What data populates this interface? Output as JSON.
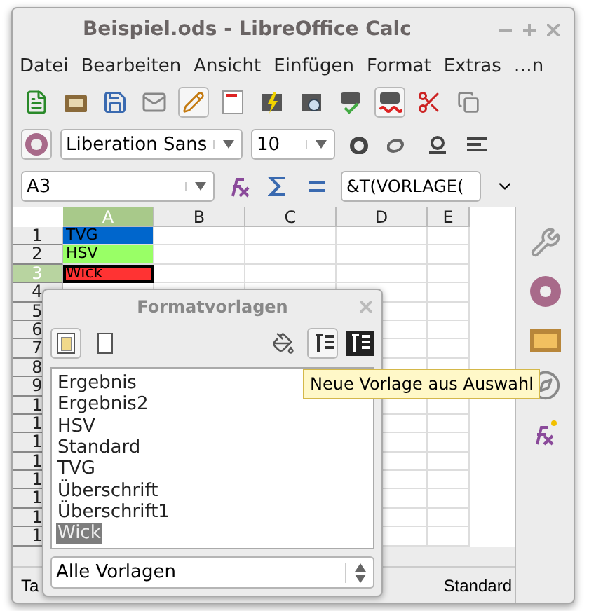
{
  "window": {
    "title": "Beispiel.ods - LibreOffice Calc"
  },
  "menu": [
    "Datei",
    "Bearbeiten",
    "Ansicht",
    "Einfügen",
    "Format",
    "Extras",
    "…n"
  ],
  "font_name": {
    "value": "Liberation Sans"
  },
  "font_size": {
    "value": "10"
  },
  "name_box": {
    "value": "A3"
  },
  "formula": {
    "value": "&T(VORLAGE("
  },
  "columns": [
    {
      "label": "A",
      "selected": true
    },
    {
      "label": "B",
      "selected": false
    },
    {
      "label": "C",
      "selected": false
    },
    {
      "label": "D",
      "selected": false
    },
    {
      "label": "E",
      "selected": false
    }
  ],
  "rows": [
    {
      "label": "1",
      "selected": false,
      "cell": {
        "text": "TVG",
        "color": "#0066cc"
      }
    },
    {
      "label": "2",
      "selected": false,
      "cell": {
        "text": "HSV",
        "color": "#99ff66"
      }
    },
    {
      "label": "3",
      "selected": true,
      "cell": {
        "text": "Wick",
        "color": "#ff3333"
      }
    },
    {
      "label": "4",
      "selected": false
    },
    {
      "label": "5",
      "selected": false
    },
    {
      "label": "6",
      "selected": false
    },
    {
      "label": "7",
      "selected": false
    },
    {
      "label": "8",
      "selected": false
    },
    {
      "label": "9",
      "selected": false
    },
    {
      "label": "1",
      "selected": false
    },
    {
      "label": "1",
      "selected": false
    },
    {
      "label": "1",
      "selected": false
    },
    {
      "label": "1",
      "selected": false
    },
    {
      "label": "1",
      "selected": false
    },
    {
      "label": "1",
      "selected": false
    },
    {
      "label": "1",
      "selected": false
    },
    {
      "label": "1",
      "selected": false
    }
  ],
  "dialog": {
    "title": "Formatvorlagen",
    "categories": [
      {
        "kind": "cell",
        "selected": true
      },
      {
        "kind": "page",
        "selected": false
      }
    ],
    "styles": [
      {
        "name": "Ergebnis",
        "selected": false
      },
      {
        "name": "Ergebnis2",
        "selected": false
      },
      {
        "name": "HSV",
        "selected": false
      },
      {
        "name": "Standard",
        "selected": false
      },
      {
        "name": "TVG",
        "selected": false
      },
      {
        "name": "Überschrift",
        "selected": false
      },
      {
        "name": "Überschrift1",
        "selected": false
      },
      {
        "name": "Wick",
        "selected": true
      }
    ],
    "filter": {
      "value": "Alle Vorlagen"
    },
    "tooltip": "Neue Vorlage aus Auswahl"
  },
  "status_bar": [
    "Ta",
    "Standard"
  ]
}
